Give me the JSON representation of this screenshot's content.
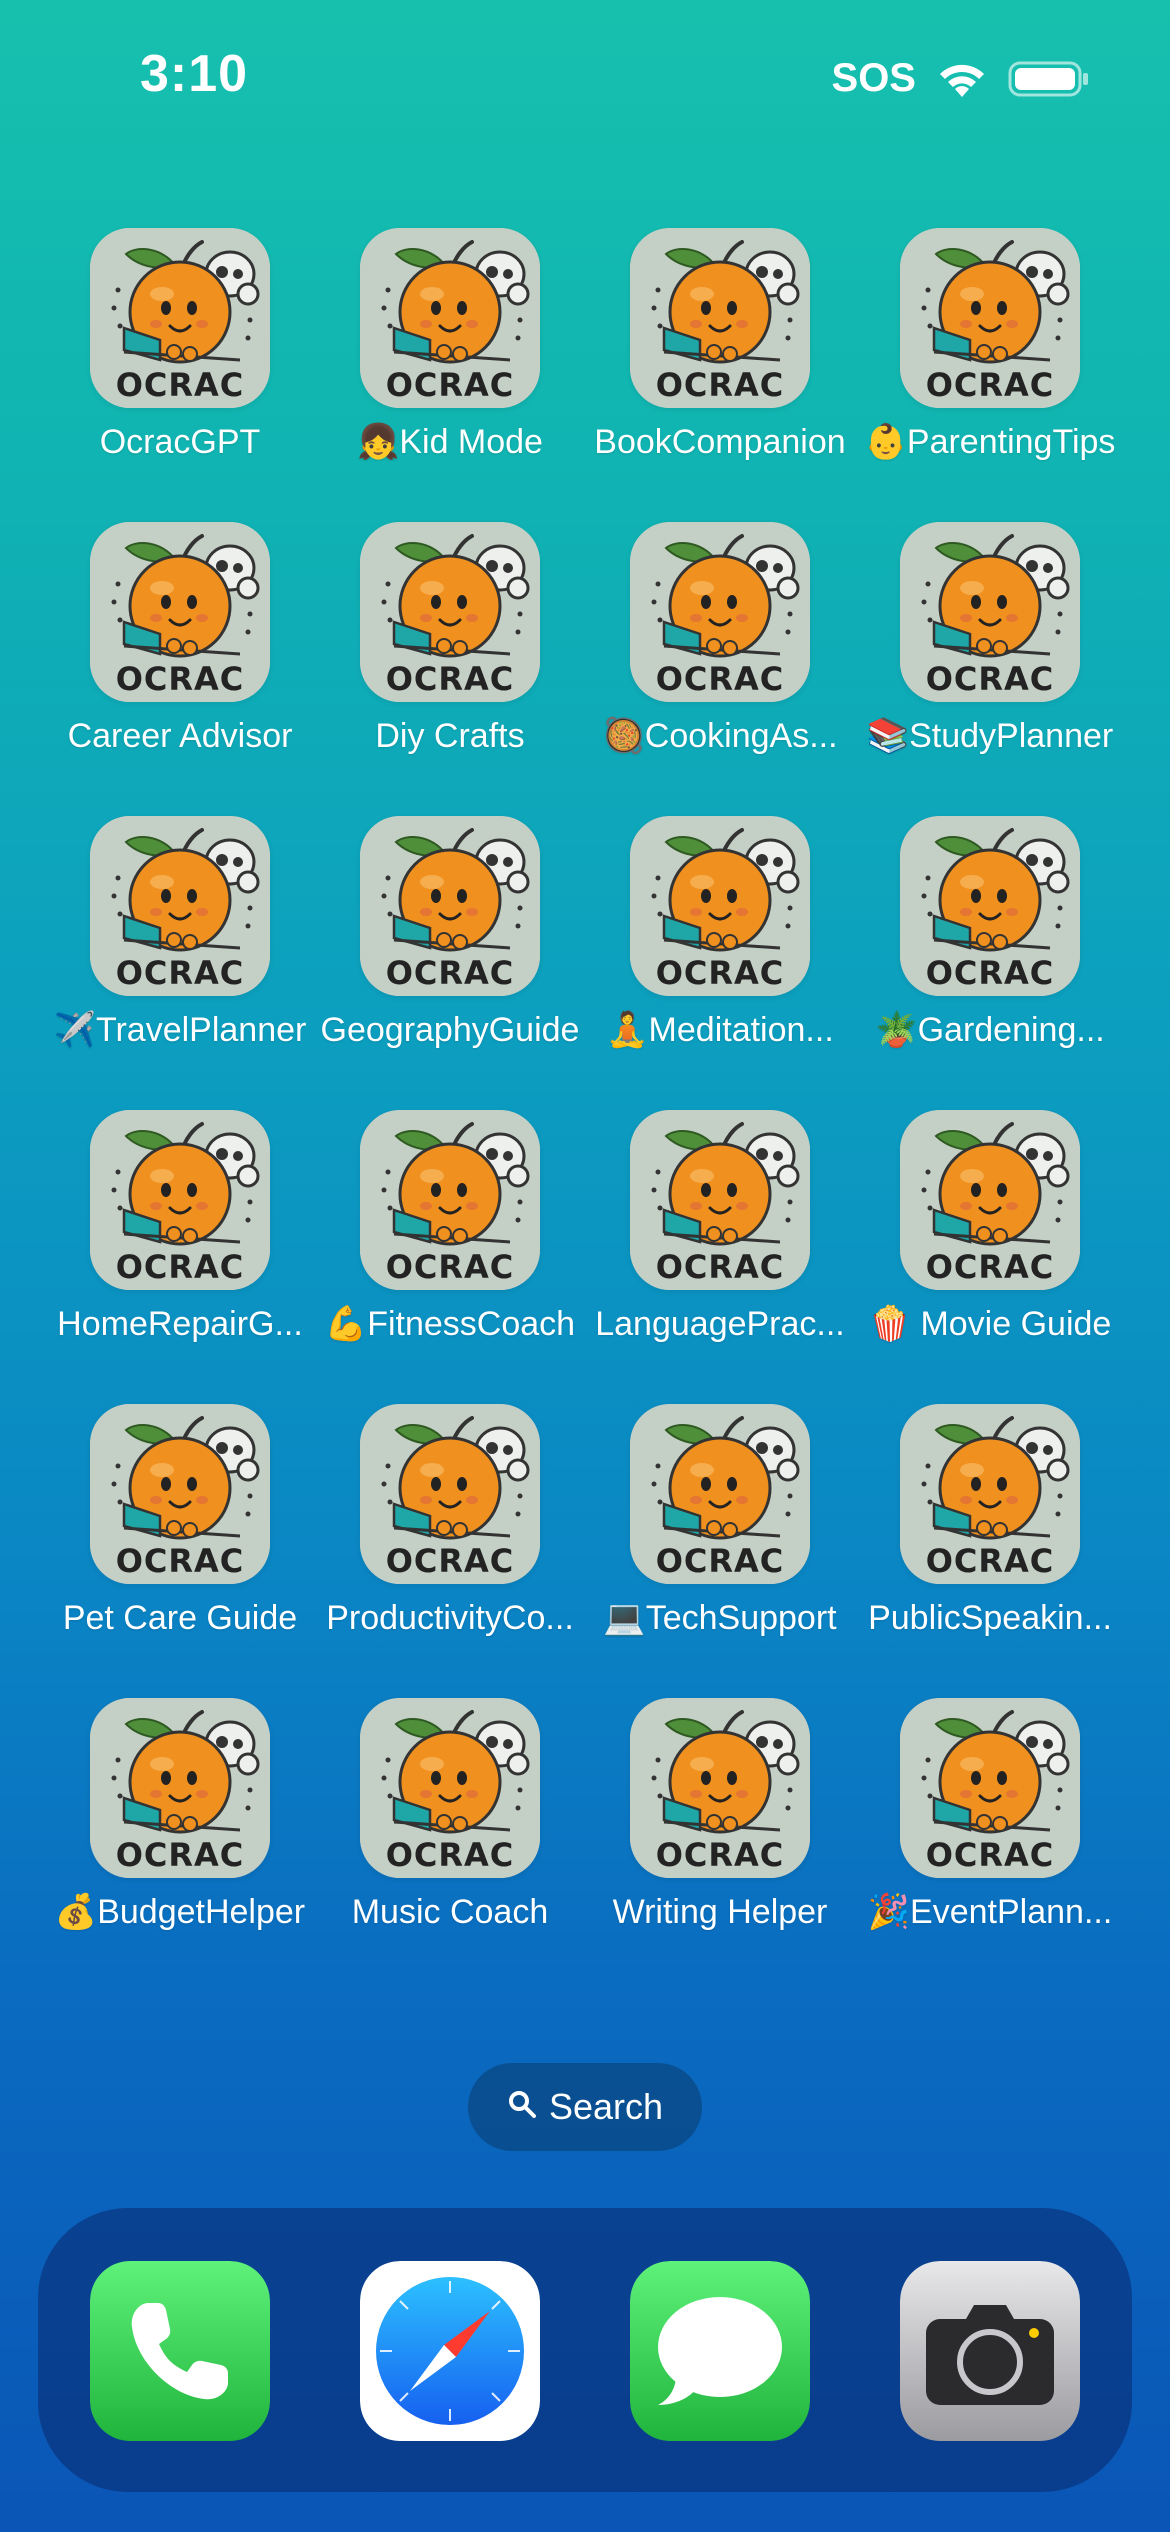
{
  "status_bar": {
    "time": "3:10",
    "sos": "SOS",
    "wifi_icon": "wifi-icon",
    "battery_icon": "battery-icon"
  },
  "icon_logo_text": "OCRAC",
  "apps": [
    {
      "label": "OcracGPT"
    },
    {
      "label": "👧Kid Mode"
    },
    {
      "label": "BookCompanion"
    },
    {
      "label": "👶ParentingTips"
    },
    {
      "label": "Career Advisor"
    },
    {
      "label": "Diy Crafts"
    },
    {
      "label": "🥘CookingAs..."
    },
    {
      "label": "📚StudyPlanner"
    },
    {
      "label": "✈️TravelPlanner"
    },
    {
      "label": "GeographyGuide"
    },
    {
      "label": "🧘Meditation..."
    },
    {
      "label": "🪴Gardening..."
    },
    {
      "label": "HomeRepairG..."
    },
    {
      "label": "💪FitnessCoach"
    },
    {
      "label": "LanguagePrac..."
    },
    {
      "label": "🍿 Movie Guide"
    },
    {
      "label": "Pet Care Guide"
    },
    {
      "label": "ProductivityCo..."
    },
    {
      "label": "💻TechSupport"
    },
    {
      "label": "PublicSpeakin..."
    },
    {
      "label": "💰BudgetHelper"
    },
    {
      "label": "Music Coach"
    },
    {
      "label": "Writing Helper"
    },
    {
      "label": "🎉EventPlann..."
    }
  ],
  "search": {
    "label": "Search",
    "icon": "magnifier-icon"
  },
  "dock": {
    "apps": [
      {
        "name": "Phone",
        "icon": "phone-icon"
      },
      {
        "name": "Safari",
        "icon": "compass-icon"
      },
      {
        "name": "Messages",
        "icon": "chat-bubble-icon"
      },
      {
        "name": "Camera",
        "icon": "camera-icon"
      }
    ]
  },
  "colors": {
    "wallpaper_top": "#16c0ad",
    "wallpaper_bottom": "#0a55b6",
    "icon_bg": "#c4cfc5",
    "orange": "#f0901e",
    "laptop": "#1fa6a6",
    "phone_green": "#34c759",
    "safari_blue": "#1a8cff"
  }
}
